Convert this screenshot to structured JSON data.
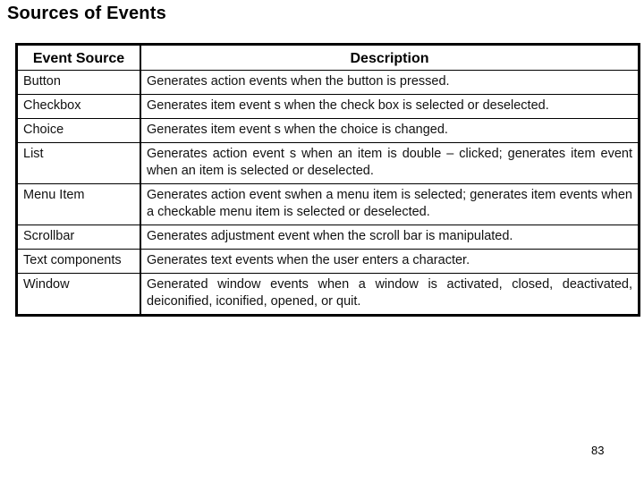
{
  "slide": {
    "title": "Sources of Events",
    "page_number": "83"
  },
  "table": {
    "headers": {
      "source": "Event Source",
      "description": "Description"
    },
    "rows": [
      {
        "source": "Button",
        "description": "Generates action events when the button is pressed."
      },
      {
        "source": "Checkbox",
        "description": "Generates item event s when the check box is selected or deselected."
      },
      {
        "source": "Choice",
        "description": "Generates item event s when the choice is changed."
      },
      {
        "source": "List",
        "description": "Generates action event s when an item is double – clicked; generates item event when an item is selected or deselected."
      },
      {
        "source": "Menu Item",
        "description": "Generates action event swhen a menu item is selected; generates item events  when a checkable menu item is selected or deselected."
      },
      {
        "source": "Scrollbar",
        "description": "Generates adjustment event when the scroll bar is manipulated."
      },
      {
        "source": "Text components",
        "description": "Generates text events when the user enters a character."
      },
      {
        "source": "Window",
        "description": "Generated window events when a window is activated, closed, deactivated, deiconified, iconified, opened, or quit."
      }
    ]
  }
}
